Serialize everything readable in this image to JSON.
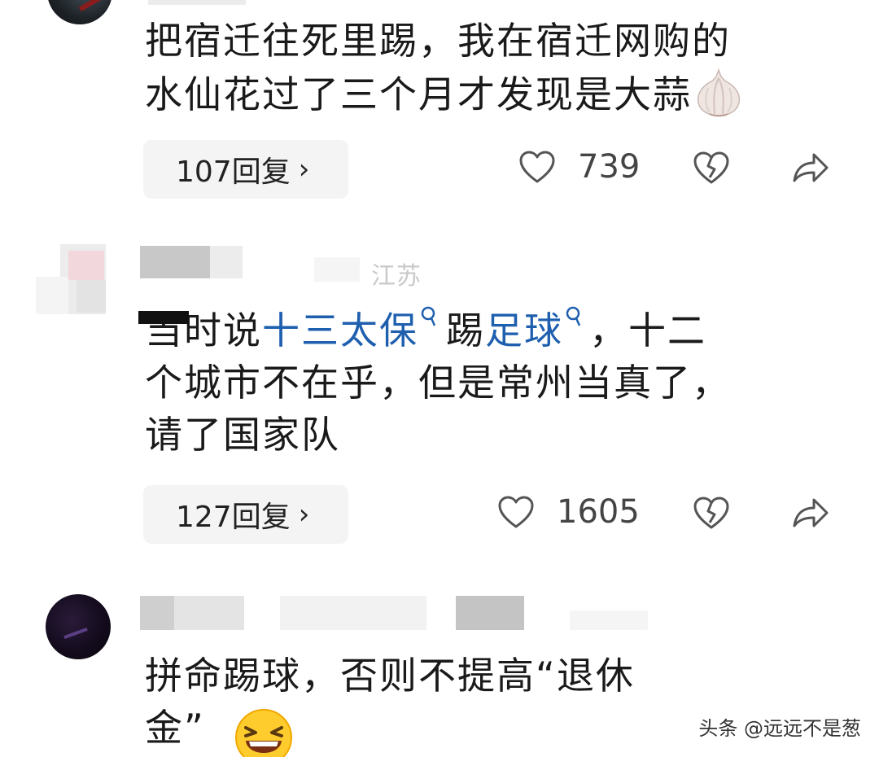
{
  "comments": [
    {
      "text_line1": "把宿迁往死里踢，我在宿迁网购的",
      "text_line2": "水仙花过了三个月才发现是大蒜",
      "replies": "107回复",
      "likes": "739"
    },
    {
      "location": "江苏",
      "line1_a": "当时说",
      "line1_kw1": "十三太保",
      "line1_b": "踢",
      "line1_kw2": "足球",
      "line1_c": "，十二",
      "text_line2": "个城市不在乎，但是常州当真了，",
      "text_line3": "请了国家队",
      "replies": "127回复",
      "likes": "1605"
    },
    {
      "text_line1": "拼命踢球，否则不提高“退休",
      "text_line2": "金”"
    }
  ],
  "chevron": "›",
  "watermark": "头条 @远远不是葱",
  "colors": {
    "link": "#1e5fae",
    "pill_bg": "#f4f4f4",
    "text": "#1a1a1a"
  },
  "icons": [
    "heart-outline-icon",
    "broken-heart-icon",
    "share-arrow-icon",
    "search-icon",
    "garlic-emoji",
    "laughing-emoji"
  ]
}
